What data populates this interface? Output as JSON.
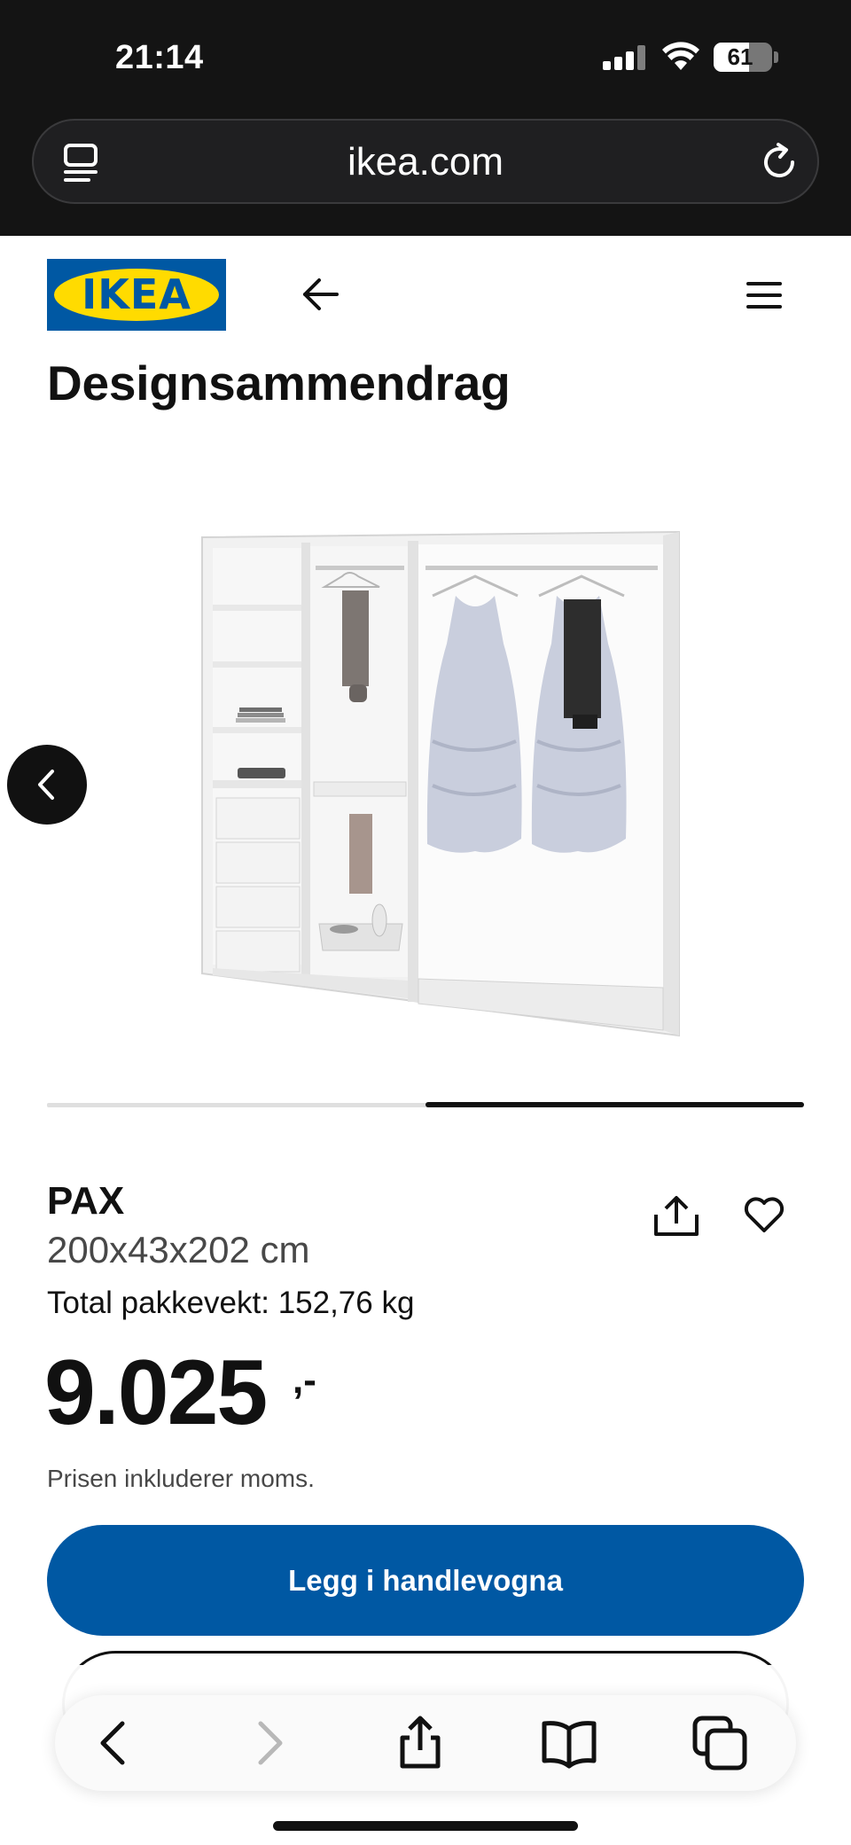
{
  "status_bar": {
    "time": "21:14",
    "battery_level": "61",
    "battery_fraction": 0.61
  },
  "browser": {
    "url": "ikea.com"
  },
  "header": {
    "logo_text": "IKEA",
    "brand_colors": {
      "blue": "#0058a3",
      "yellow": "#ffdb00"
    }
  },
  "page": {
    "title": "Designsammendrag"
  },
  "carousel": {
    "current_slide": 2,
    "total_slides": 2
  },
  "product": {
    "name": "PAX",
    "dimensions": "200x43x202 cm",
    "weight": "Total pakkevekt: 152,76 kg",
    "price": "9.025",
    "price_suffix": ",-",
    "vat_note": "Prisen inkluderer moms."
  },
  "actions": {
    "add_to_cart": "Legg i handlevogna"
  },
  "icons": {
    "back": "back-arrow-icon",
    "menu": "menu-icon",
    "share": "share-icon",
    "favourite": "heart-icon"
  }
}
